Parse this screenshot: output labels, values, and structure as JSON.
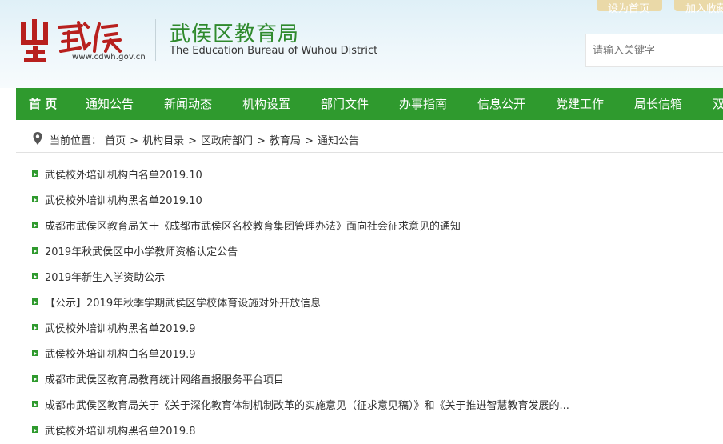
{
  "header": {
    "logo_url": "www.cdwh.gov.cn",
    "title_cn": "武侯区教育局",
    "title_en": "The Education Bureau of Wuhou District",
    "top_buttons": [
      "设为首页",
      "加入收藏"
    ],
    "search_placeholder": "请输入关键字"
  },
  "nav": {
    "items": [
      "首 页",
      "通知公告",
      "新闻动态",
      "机构设置",
      "部门文件",
      "办事指南",
      "信息公开",
      "党建工作",
      "局长信箱",
      "双"
    ]
  },
  "breadcrumb": {
    "label": "当前位置：",
    "items": [
      "首页",
      "机构目录",
      "区政府部门",
      "教育局",
      "通知公告"
    ]
  },
  "articles": [
    "武侯校外培训机构白名单2019.10",
    "武侯校外培训机构黑名单2019.10",
    "成都市武侯区教育局关于《成都市武侯区名校教育集团管理办法》面向社会征求意见的通知",
    "2019年秋武侯区中小学教师资格认定公告",
    "2019年新生入学资助公示",
    "【公示】2019年秋季学期武侯区学校体育设施对外开放信息",
    "武侯校外培训机构黑名单2019.9",
    "武侯校外培训机构白名单2019.9",
    "成都市武侯区教育局教育统计网络直报服务平台项目",
    "成都市武侯区教育局关于《关于深化教育体制机制改革的实施意见（征求意见稿）》和《关于推进智慧教育发展的...",
    "武侯校外培训机构黑名单2019.8"
  ],
  "colors": {
    "nav_green": "#2f9a2e",
    "title_green": "#2f8a2d",
    "logo_red": "#b8201e",
    "button_gold": "#ead9a8"
  }
}
